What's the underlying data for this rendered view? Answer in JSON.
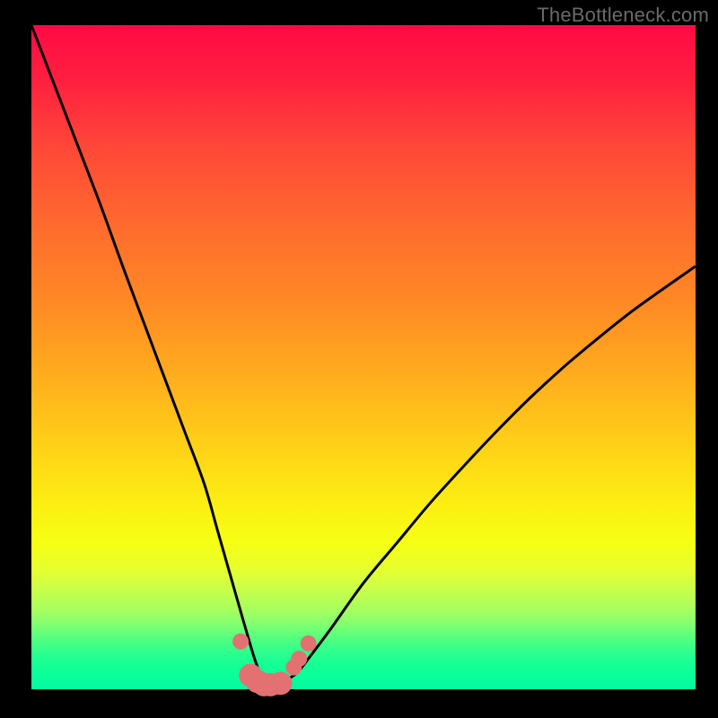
{
  "watermark": "TheBottleneck.com",
  "colors": {
    "frame": "#000000",
    "curve": "#000000",
    "marker": "#e37171",
    "gradient_top": "#ff0a44",
    "gradient_bottom": "#06f7a0"
  },
  "chart_data": {
    "type": "line",
    "title": "",
    "xlabel": "",
    "ylabel": "",
    "xlim": [
      0,
      100
    ],
    "ylim": [
      0,
      100
    ],
    "grid": false,
    "legend": false,
    "annotations": [
      "TheBottleneck.com"
    ],
    "series": [
      {
        "name": "bottleneck-curve",
        "x": [
          0,
          5,
          10,
          14,
          17,
          20,
          23,
          26,
          28,
          30,
          32,
          33.8,
          35,
          36.5,
          38,
          40,
          42,
          45,
          50,
          55,
          60,
          65,
          70,
          75,
          80,
          85,
          90,
          95,
          100
        ],
        "values": [
          100,
          87,
          74,
          63,
          55,
          47,
          39,
          31,
          24,
          17,
          10,
          4,
          1.5,
          0.7,
          1.2,
          2.5,
          5,
          9,
          16,
          22,
          28,
          33.5,
          38.8,
          43.8,
          48.4,
          52.6,
          56.6,
          60.2,
          63.7
        ]
      },
      {
        "name": "trough-markers",
        "x": [
          31.5,
          33.0,
          34.0,
          35.0,
          36.0,
          37.5,
          39.5,
          40.3,
          41.7
        ],
        "values": [
          7.2,
          2.1,
          1.2,
          0.7,
          0.7,
          0.9,
          3.3,
          4.6,
          6.9
        ]
      }
    ]
  }
}
